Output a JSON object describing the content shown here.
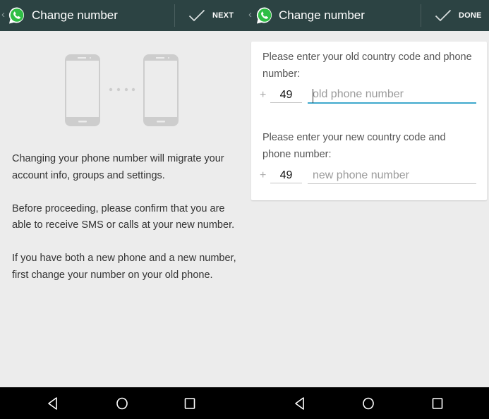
{
  "left_screen": {
    "actionbar": {
      "back_icon": "chevron-left-icon",
      "logo_icon": "whatsapp-logo-icon",
      "title": "Change number",
      "action_icon": "checkmark-icon",
      "action_label": "NEXT"
    },
    "illustration": {
      "icon": "phone-to-phone-illustration"
    },
    "info_paragraphs": [
      "Changing your phone number will migrate your account info, groups and settings.",
      "Before proceeding, please confirm that you are able to receive SMS or calls at your new number.",
      "If you have both a new phone and a new number, first change your number on your old phone."
    ],
    "navbar": {
      "back_icon": "nav-back-triangle-icon",
      "home_icon": "nav-home-circle-icon",
      "recents_icon": "nav-recents-square-icon"
    }
  },
  "right_screen": {
    "actionbar": {
      "back_icon": "chevron-left-icon",
      "logo_icon": "whatsapp-logo-icon",
      "title": "Change number",
      "action_icon": "checkmark-icon",
      "action_label": "DONE"
    },
    "old_number": {
      "prompt": "Please enter your old country code and phone number:",
      "plus_sign": "+",
      "country_code": "49",
      "phone_value": "",
      "phone_placeholder": "old phone number",
      "focused": true
    },
    "new_number": {
      "prompt": "Please enter your new country code and phone number:",
      "plus_sign": "+",
      "country_code": "49",
      "phone_value": "",
      "phone_placeholder": "new phone number",
      "focused": false
    },
    "navbar": {
      "back_icon": "nav-back-triangle-icon",
      "home_icon": "nav-home-circle-icon",
      "recents_icon": "nav-recents-square-icon"
    }
  },
  "colors": {
    "actionbar_bg": "#2c4343",
    "whatsapp_green": "#2fbe45",
    "focus_accent": "#3ea8cc",
    "background": "#ececec",
    "navbar_bg": "#000000"
  }
}
